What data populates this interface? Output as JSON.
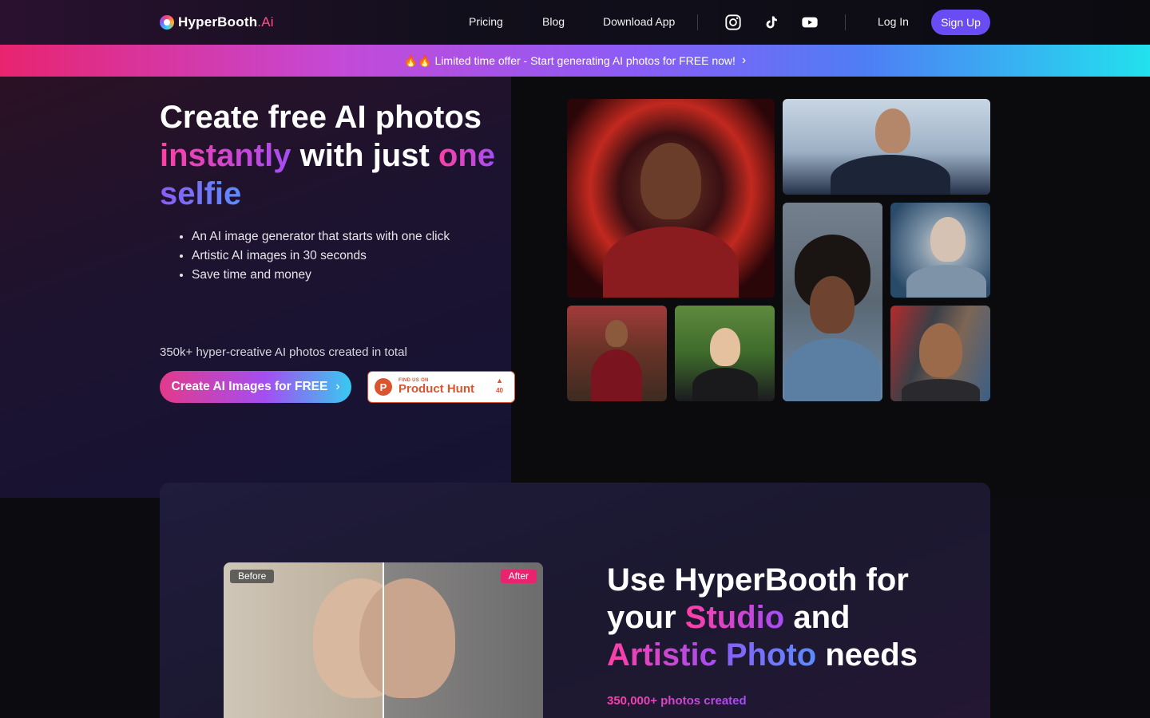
{
  "nav": {
    "logo_main": "HyperBooth",
    "logo_suffix": ".Ai",
    "links": [
      "Pricing",
      "Blog",
      "Download App"
    ],
    "social": [
      "instagram-icon",
      "tiktok-icon",
      "youtube-icon"
    ],
    "login": "Log In",
    "signup": "Sign Up"
  },
  "promo": {
    "text": "🔥🔥 Limited time offer - Start generating AI photos for FREE now!",
    "chevron": "›"
  },
  "hero": {
    "title_part1": "Create free AI photos",
    "title_part2": "instantly",
    "title_part3": " with just ",
    "title_part4": "one",
    "title_part5": "selfie",
    "bullets": [
      "An AI image generator that starts with one click",
      "Artistic AI images in 30 seconds",
      "Save time and money"
    ],
    "stat": "350k+ hyper-creative AI photos created in total",
    "cta": "Create AI Images for FREE",
    "cta_chevron": "›",
    "producthunt": {
      "small": "FIND US ON",
      "big": "Product Hunt",
      "count": "40"
    }
  },
  "feature": {
    "before": "Before",
    "after": "After",
    "title_part1": "Use HyperBooth for",
    "title_part2": "your ",
    "title_part3": "Studio",
    "title_part4": " and",
    "title_part5": "Artistic",
    "title_part6": " Photo",
    "title_part7": " needs",
    "stat": "350,000+ photos created"
  },
  "colors": {
    "accent_purple": "#6a4cf5",
    "pink": "#e8246f",
    "cyan": "#22e1ee"
  }
}
